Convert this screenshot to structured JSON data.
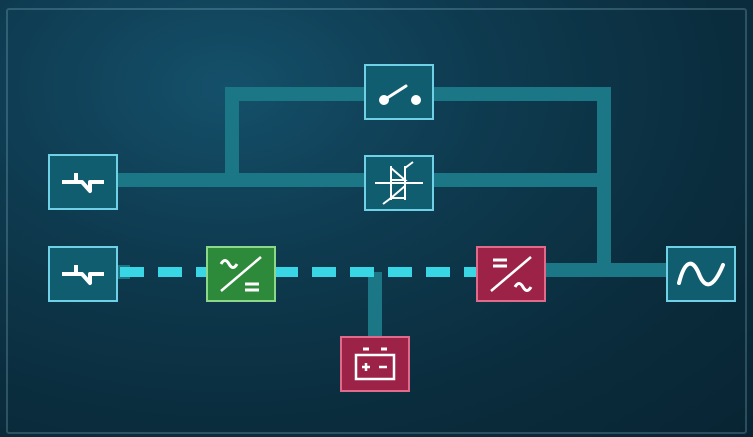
{
  "screen": {
    "title": "",
    "colors": {
      "line": "#1b7685",
      "energy_flow": "#39d6e6",
      "block_teal": "#0f5d6f",
      "block_green": "#2d8a3a",
      "block_red": "#9c2347"
    }
  },
  "blocks": [
    {
      "id": "bypass-input",
      "icon": "ac-input-icon",
      "kind": "Bypass input"
    },
    {
      "id": "main-input",
      "icon": "ac-input-icon",
      "kind": "Main input"
    },
    {
      "id": "maintenance-switch",
      "icon": "switch-open-icon",
      "kind": "Maintenance bypass switch"
    },
    {
      "id": "static-switch",
      "icon": "thyristor-icon",
      "kind": "Static bypass switch"
    },
    {
      "id": "rectifier",
      "icon": "rectifier-ac-dc-icon",
      "kind": "Rectifier",
      "status": "active"
    },
    {
      "id": "inverter",
      "icon": "inverter-dc-ac-icon",
      "kind": "Inverter",
      "status": "alarm"
    },
    {
      "id": "battery",
      "icon": "battery-icon",
      "kind": "Battery",
      "status": "alarm"
    },
    {
      "id": "output",
      "icon": "sine-output-icon",
      "kind": "Output"
    }
  ],
  "flows": {
    "main_path_active": true,
    "bypass_path_active": false
  }
}
